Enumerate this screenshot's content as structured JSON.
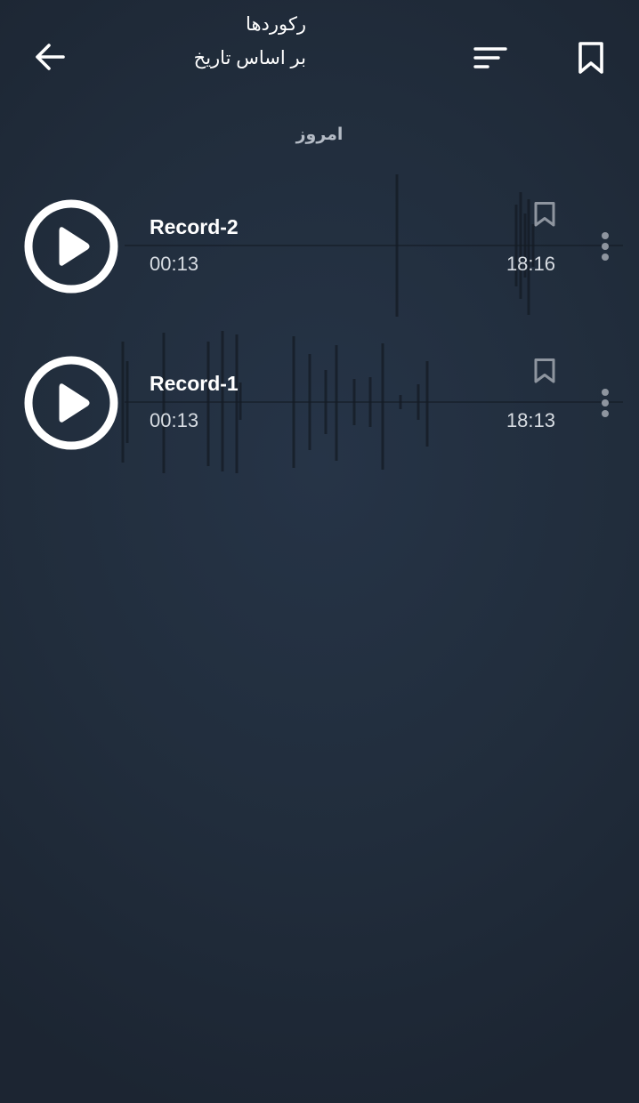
{
  "header": {
    "title": "رکوردها",
    "subtitle": "بر اساس تاریخ",
    "back_icon": "arrow-left-icon",
    "sort_icon": "sort-icon",
    "bookmark_icon": "bookmark-icon"
  },
  "section": {
    "label": "امروز"
  },
  "records": [
    {
      "name": "Record-2",
      "duration": "00:13",
      "time": "18:16",
      "icons": [
        "play-icon",
        "bookmark-outline-icon",
        "more-vert-icon"
      ]
    },
    {
      "name": "Record-1",
      "duration": "00:13",
      "time": "18:13",
      "icons": [
        "play-icon",
        "bookmark-outline-icon",
        "more-vert-icon"
      ]
    }
  ],
  "colors": {
    "background": "#222d3c",
    "text_primary": "#ffffff",
    "text_secondary": "#d8dde3",
    "icon_muted": "#8e959f",
    "section_header": "#b4bbc5",
    "waveform": "#141b24"
  }
}
